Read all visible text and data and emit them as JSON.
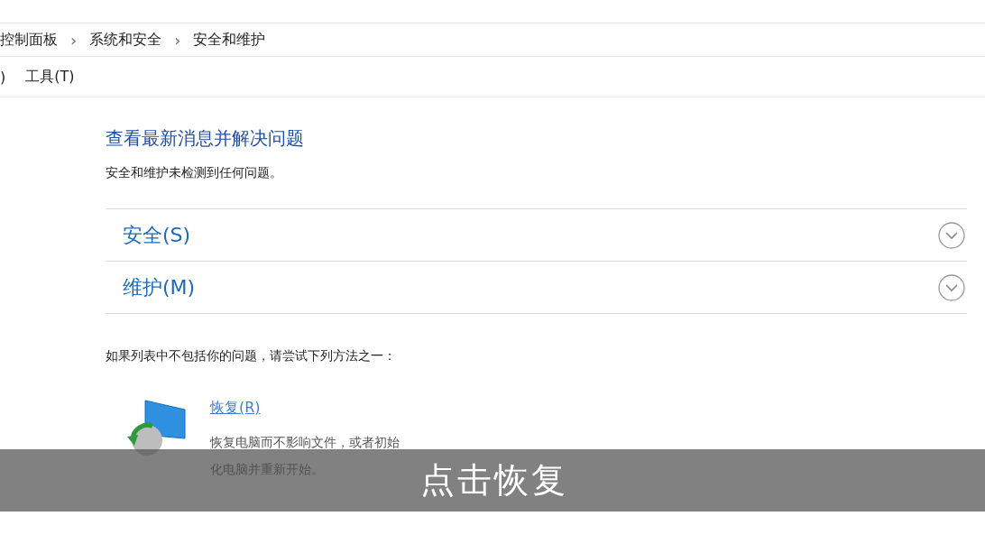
{
  "breadcrumb": [
    "控制面板",
    "系统和安全",
    "安全和维护"
  ],
  "breadcrumb_separator": "›",
  "menu": [
    ")",
    "工具(T)"
  ],
  "heading": "查看最新消息并解决问题",
  "status": "安全和维护未检测到任何问题。",
  "sections": [
    {
      "label": "安全(S)",
      "expanded": false
    },
    {
      "label": "维护(M)",
      "expanded": false
    }
  ],
  "hint": "如果列表中不包括你的问题，请尝试下列方法之一：",
  "recovery": {
    "link": "恢复(R)",
    "description": "恢复电脑而不影响文件，或者初始化电脑并重新开始。"
  },
  "subtitle": "点击恢复"
}
